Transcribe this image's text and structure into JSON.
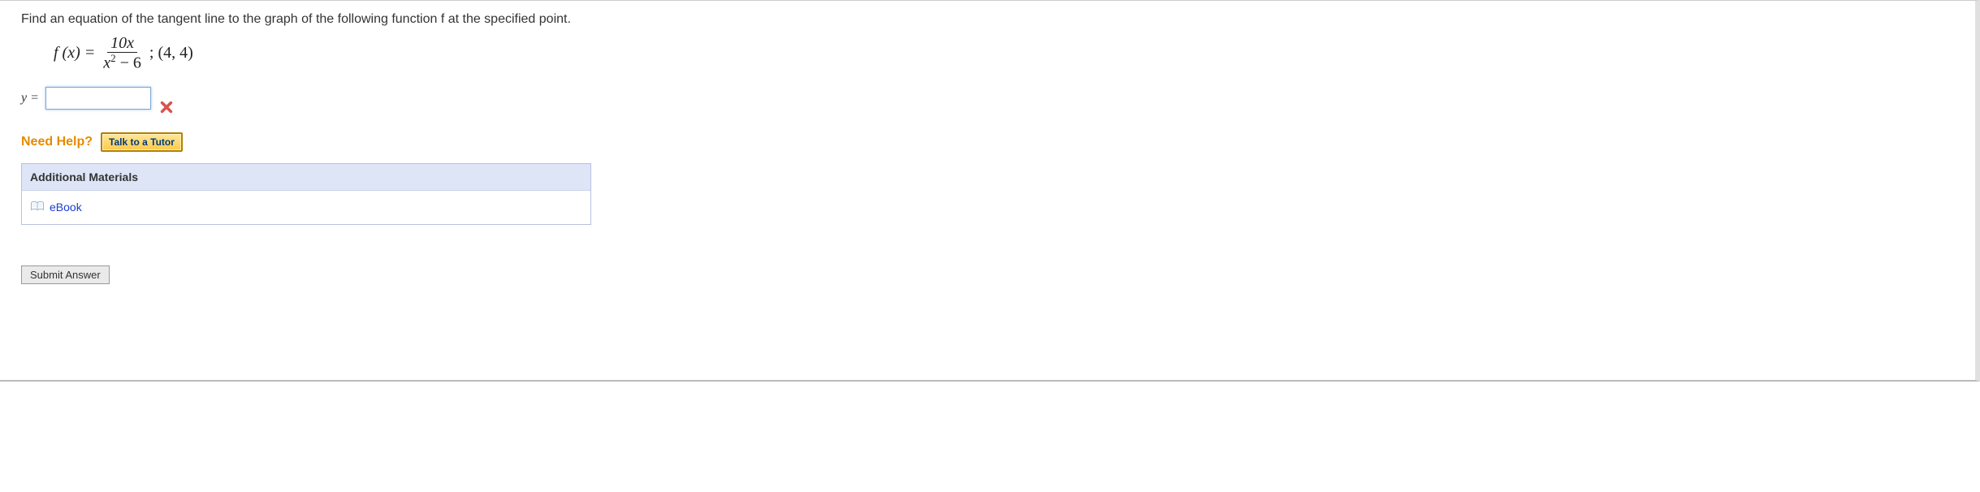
{
  "question": {
    "prompt": "Find an equation of the tangent line to the graph of the following function f at the specified point.",
    "function_lhs": "f (x) =",
    "numerator": "10x",
    "denominator_pre": "x",
    "denominator_exp": "2",
    "denominator_post": " − 6",
    "point": "; (4, 4)"
  },
  "answer": {
    "label": "y =",
    "value": ""
  },
  "help": {
    "label": "Need Help?",
    "tutor_button": "Talk to a Tutor"
  },
  "materials": {
    "header": "Additional Materials",
    "ebook": "eBook"
  },
  "submit": {
    "label": "Submit Answer"
  }
}
